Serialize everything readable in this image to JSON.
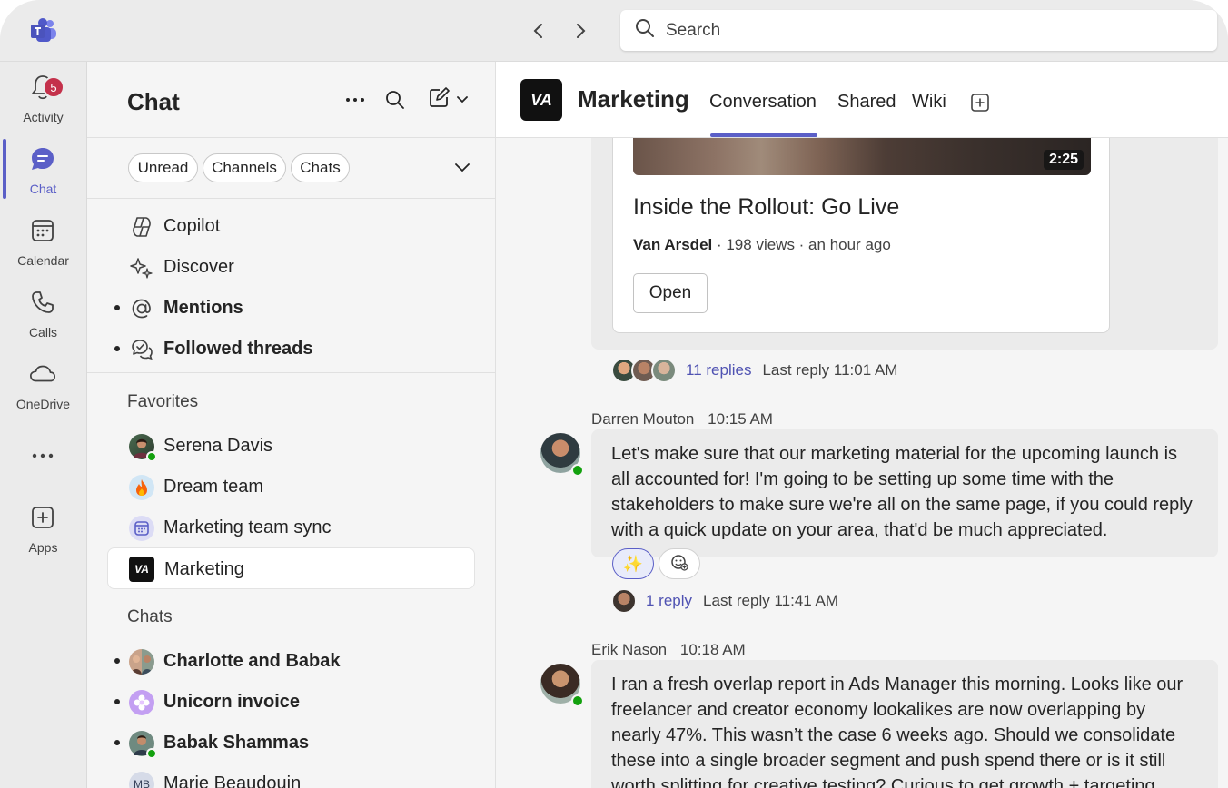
{
  "search": {
    "placeholder": "Search"
  },
  "rail": {
    "items": [
      {
        "label": "Activity",
        "icon": "bell-icon"
      },
      {
        "label": "Chat",
        "icon": "chat-icon",
        "badge": "5"
      },
      {
        "label": "Calendar",
        "icon": "calendar-icon"
      },
      {
        "label": "Calls",
        "icon": "phone-icon"
      },
      {
        "label": "OneDrive",
        "icon": "cloud-icon"
      },
      {
        "label": "Apps",
        "icon": "plus-square-icon"
      }
    ]
  },
  "panel": {
    "title": "Chat",
    "filters": [
      "Unread",
      "Channels",
      "Chats"
    ],
    "top_items": [
      {
        "label": "Copilot",
        "icon": "copilot-icon",
        "bold": false,
        "unread": false
      },
      {
        "label": "Discover",
        "icon": "sparkle-icon",
        "bold": false,
        "unread": false
      },
      {
        "label": "Mentions",
        "icon": "at-icon",
        "bold": true,
        "unread": true
      },
      {
        "label": "Followed threads",
        "icon": "followed-threads-icon",
        "bold": true,
        "unread": true
      }
    ],
    "favorites_label": "Favorites",
    "favorites": [
      {
        "label": "Serena Davis",
        "icon": "avatar"
      },
      {
        "label": "Dream team",
        "icon": "fire-icon"
      },
      {
        "label": "Marketing team sync",
        "icon": "calendar-icon"
      },
      {
        "label": "Marketing",
        "icon": "va-logo",
        "logo_text": "VA"
      }
    ],
    "chats_label": "Chats",
    "chats": [
      {
        "label": "Charlotte and Babak",
        "bold": true,
        "unread": true
      },
      {
        "label": "Unicorn invoice",
        "bold": true,
        "unread": true
      },
      {
        "label": "Babak Shammas",
        "bold": true,
        "unread": true
      },
      {
        "label": "Marie Beaudouin",
        "bold": false,
        "unread": false,
        "initials": "MB"
      }
    ]
  },
  "channel": {
    "logo_text": "VA",
    "name": "Marketing",
    "tabs": [
      "Conversation",
      "Shared",
      "Wiki"
    ]
  },
  "video_post": {
    "duration": "2:25",
    "title": "Inside the Rollout: Go Live",
    "author": "Van Arsdel",
    "meta": " · 198 views · an hour ago",
    "open_label": "Open",
    "replies": "11 replies",
    "last_reply": "Last reply 11:01 AM"
  },
  "messages": [
    {
      "author": "Darren Mouton",
      "time": "10:15 AM",
      "text": "Let's make sure that our marketing material for the upcoming launch is all accounted for! I'm going to be setting up some time with the stakeholders to make sure we're all on the same page, if you could reply with a quick update on your area, that'd be much appreciated.",
      "reaction": "✨",
      "replies": "1 reply",
      "last_reply": "Last reply 11:41 AM"
    },
    {
      "author": "Erik Nason",
      "time": "10:18 AM",
      "text": "I ran a fresh overlap report in Ads Manager this morning. Looks like our freelancer and creator economy lookalikes are now overlapping by nearly 47%. This wasn’t the case 6 weeks ago. Should we consolidate these into a single broader segment and push spend there or is it still worth splitting for creative testing? Curious to get growth + targeting POVs before we"
    }
  ],
  "colors": {
    "accent": "#5b5fc7",
    "badge": "#c4314b",
    "presence": "#13a10e",
    "link": "#4f52b2"
  }
}
